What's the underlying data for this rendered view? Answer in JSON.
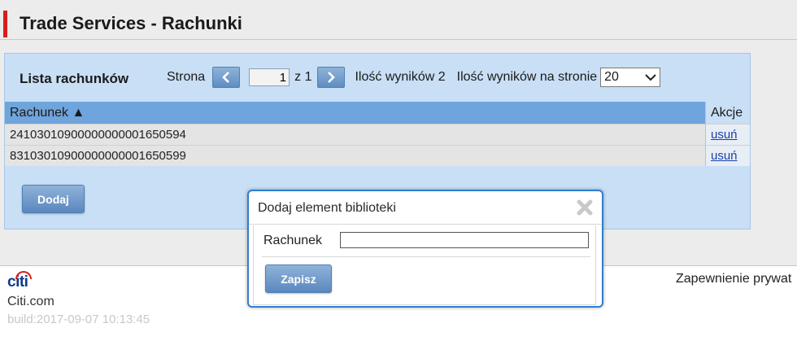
{
  "header": {
    "title": "Trade Services - Rachunki"
  },
  "list": {
    "title": "Lista rachunków",
    "page_label": "Strona",
    "prev_icon": "chevron-left-icon",
    "page_value": "1",
    "of_label": "z 1",
    "next_icon": "chevron-right-icon",
    "results_count": "Ilość wyników 2",
    "per_page_label": "Ilość wyników na stronie",
    "per_page_value": "20",
    "columns": {
      "account": "Rachunek ▲",
      "actions": "Akcje"
    },
    "rows": [
      {
        "account": "24103010900000000001650594",
        "action": "usuń"
      },
      {
        "account": "83103010900000000001650599",
        "action": "usuń"
      }
    ],
    "add_button": "Dodaj"
  },
  "modal": {
    "title": "Dodaj element biblioteki",
    "close_icon": "close-icon",
    "field_label": "Rachunek",
    "field_value": "",
    "save_button": "Zapisz"
  },
  "footer": {
    "logo": "citi",
    "site": "Citi.com",
    "build": "build:2017-09-07 10:13:45",
    "privacy": "Zapewnienie prywat"
  },
  "colors": {
    "brand_red": "#d61e1e",
    "panel_blue": "#c8dff5",
    "header_blue": "#6fa4dc",
    "button_blue": "#5b87bf"
  }
}
